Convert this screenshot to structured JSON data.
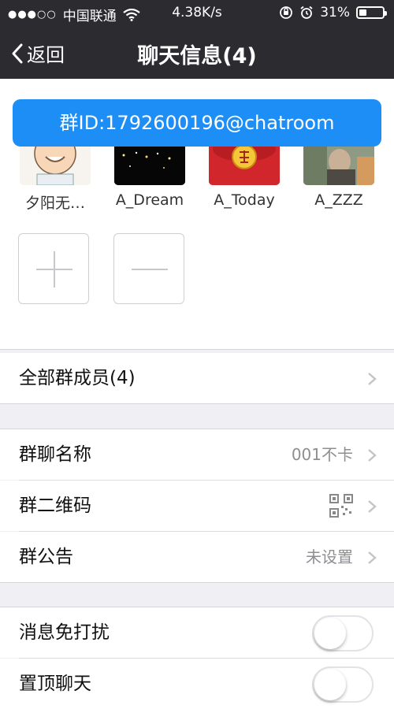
{
  "status_bar": {
    "carrier": "中国联通",
    "speed": "4.38K/s",
    "battery": "31%",
    "battery_level": 0.31
  },
  "nav": {
    "back_label": "返回",
    "title": "聊天信息(4)"
  },
  "toast": {
    "text": "群ID:1792600196@chatroom"
  },
  "members": [
    {
      "name": "夕阳无…"
    },
    {
      "name": "A_Dream"
    },
    {
      "name": "A_Today"
    },
    {
      "name": "A_ZZZ"
    }
  ],
  "all_members": {
    "label": "全部群成员(4)"
  },
  "group_settings": {
    "name_label": "群聊名称",
    "name_value": "001不卡",
    "qr_label": "群二维码",
    "notice_label": "群公告",
    "notice_value": "未设置"
  },
  "toggles": {
    "mute_label": "消息免打扰",
    "mute_on": false,
    "pin_label": "置顶聊天",
    "pin_on": false
  },
  "colors": {
    "nav_bg": "#2b2b30",
    "toast_bg": "#1e8ef7",
    "page_bg": "#efeff4"
  }
}
